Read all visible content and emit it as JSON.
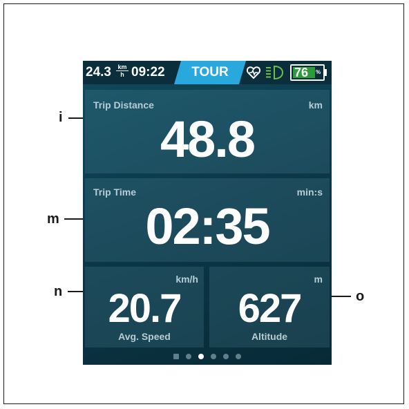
{
  "status_bar": {
    "speed": "24.3",
    "speed_unit_top": "km",
    "speed_unit_bottom": "h",
    "clock": "09:22",
    "mode": "TOUR",
    "heart_icon": "heart-pulse-icon",
    "light_icon": "headlight-icon",
    "battery_percent": "76",
    "battery_percent_sign": "%",
    "battery_level": 0.76,
    "colors": {
      "mode_tab": "#29a8de",
      "battery_fill": "#2e9a3a",
      "light_icon": "#6cc04a"
    }
  },
  "tiles": {
    "trip_distance": {
      "label": "Trip Distance",
      "unit": "km",
      "value": "48.8"
    },
    "trip_time": {
      "label": "Trip Time",
      "unit": "min:s",
      "value": "02:35"
    },
    "avg_speed": {
      "label": "Avg. Speed",
      "unit": "km/h",
      "value": "20.7"
    },
    "altitude": {
      "label": "Altitude",
      "unit": "m",
      "value": "627"
    }
  },
  "pagination": {
    "total_pages": 6,
    "active_page": 3
  },
  "callouts": {
    "i": "i",
    "m": "m",
    "n": "n",
    "o": "o"
  }
}
